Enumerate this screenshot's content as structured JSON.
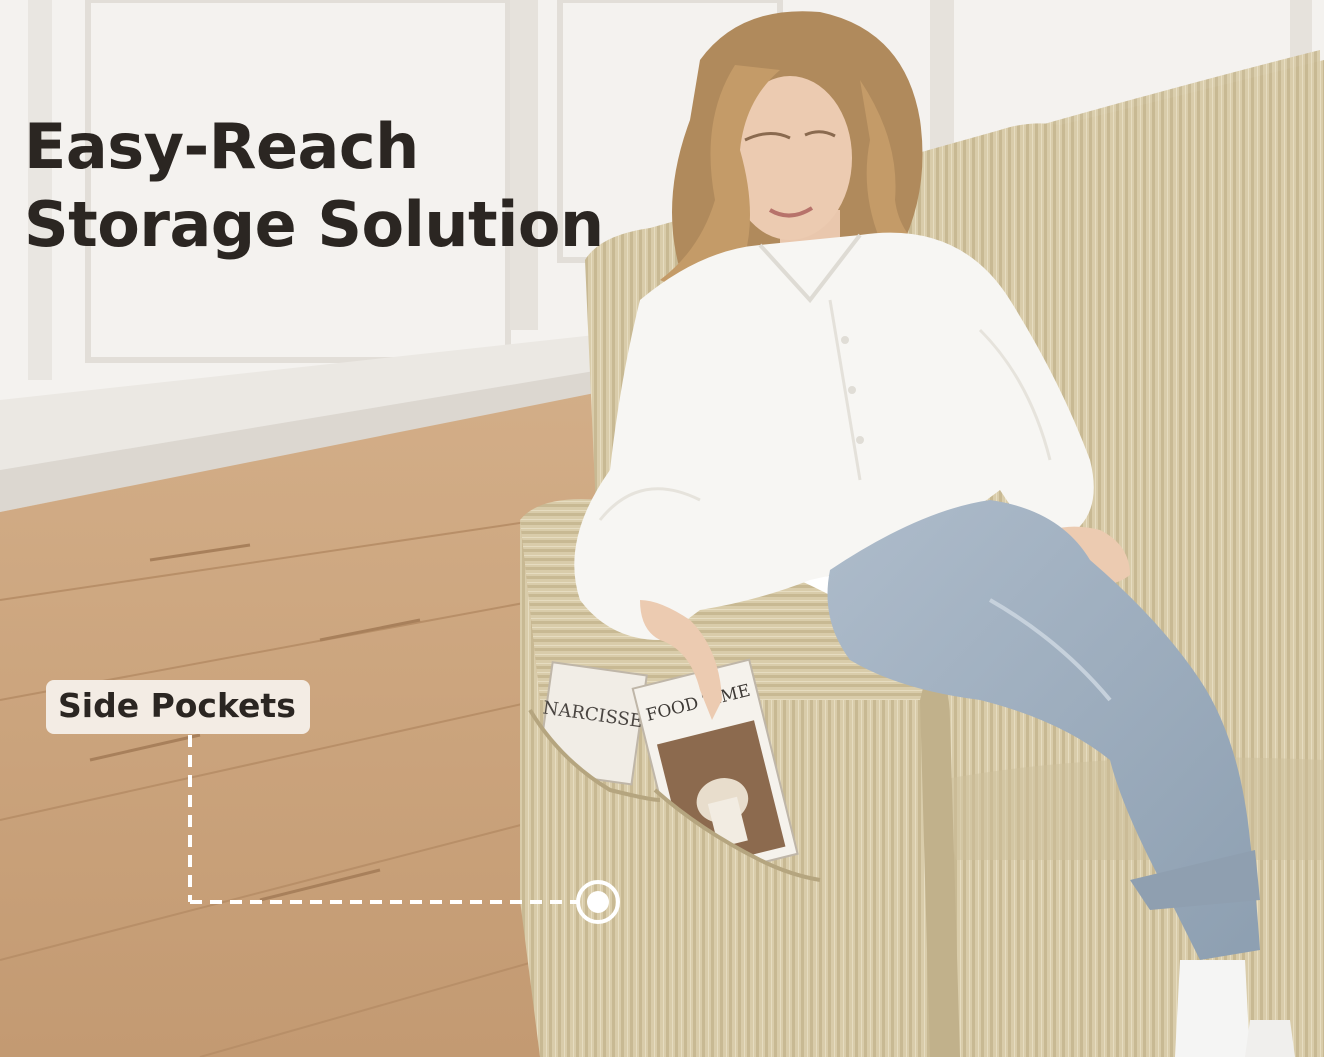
{
  "headline": {
    "line1": "Easy-Reach",
    "line2": "Storage Solution"
  },
  "callout": {
    "label": "Side Pockets"
  },
  "magazines": {
    "left_cover": "NARCISSE",
    "right_cover": "FOOD TIME"
  },
  "colors": {
    "text_dark": "#2b2622",
    "label_bg": "#f3ece4",
    "wall": "#f4f2ef",
    "floor": "#c9a27c",
    "sofa_fabric": "#d8cba9",
    "shirt": "#f7f6f3",
    "jeans": "#9fb0bf",
    "callout_line": "#ffffff"
  }
}
